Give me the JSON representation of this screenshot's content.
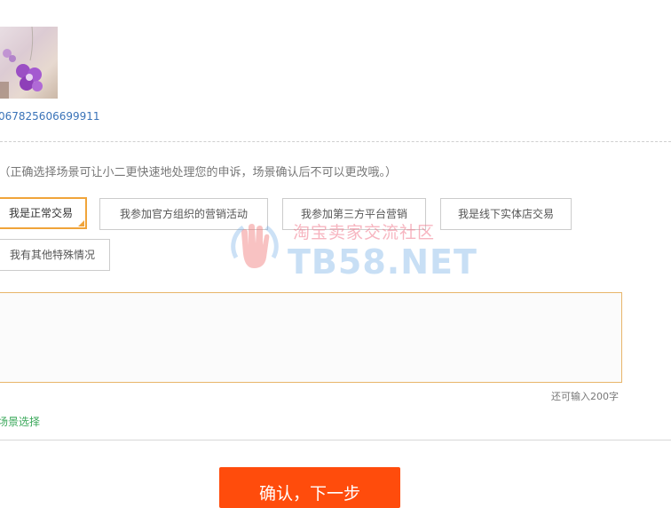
{
  "header": {
    "label": "："
  },
  "order": {
    "id": "067825606699911"
  },
  "scene": {
    "title_suffix": "：",
    "hint": "（正确选择场景可让小二更快速地处理您的申诉，场景确认后不可以更改哦。）",
    "options": [
      {
        "label": "我是正常交易",
        "selected": true
      },
      {
        "label": "我参加官方组织的营销活动",
        "selected": false
      },
      {
        "label": "我参加第三方平台营销",
        "selected": false
      },
      {
        "label": "我是线下实体店交易",
        "selected": false
      },
      {
        "label": "我有其他特殊情况",
        "selected": false
      }
    ]
  },
  "textarea": {
    "value": "",
    "placeholder": "",
    "remaining": "还可输入200字"
  },
  "reselect": {
    "label": "场景选择"
  },
  "confirm": {
    "label": "确认，下一步"
  },
  "watermark": {
    "cn": "淘宝卖家交流社区",
    "en": "TB58.NET"
  },
  "colors": {
    "accent": "#f0a43a",
    "confirm": "#ff4c0c",
    "link": "#3a73b8",
    "green": "#3aa85a"
  }
}
